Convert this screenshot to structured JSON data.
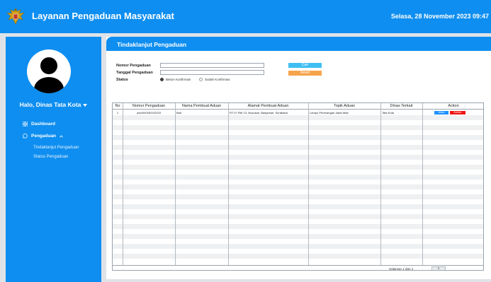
{
  "header": {
    "title": "Layanan Pengaduan Masyarakat",
    "date": "Selasa, 28 November 2023 09:47"
  },
  "sidebar": {
    "greeting": "Halo, Dinas Tata Kota",
    "items": [
      {
        "label": "Dashboard",
        "icon": "grid-icon"
      },
      {
        "label": "Pengaduan",
        "icon": "whatsapp-icon",
        "expanded": true
      }
    ],
    "subitems": [
      {
        "label": "Tindaklanjut Pengaduan"
      },
      {
        "label": "Status Pengaduan"
      }
    ]
  },
  "page": {
    "title": "Tindaklanjut Pengaduan"
  },
  "form": {
    "nomor_label": "Nomor Pengaduan",
    "nomor_value": "",
    "tanggal_label": "Tanggal Pengaduan",
    "tanggal_value": "",
    "status_label": "Status",
    "status_options": [
      "Belum Konfirmasi",
      "Sudah Konfirmasi"
    ],
    "status_selected": "Belum Konfirmasi",
    "cari_label": "Cari",
    "reset_label": "Reset"
  },
  "table": {
    "columns": [
      "No",
      "Nomor Pengaduan",
      "Nama Pembuat Aduan",
      "Alamat Pembuat Aduan",
      "Topik Aduan",
      "Dinas Terkait",
      "Action"
    ],
    "rows": [
      {
        "no": "1",
        "nomor": "adu/00045/XI/2023",
        "nama": "Bari",
        "alamat": "RT 07 RW 13, Nusukan, Banjarsari, Surakarta",
        "topik": "Lampu Penerangan Jalan Mati",
        "dinas": "Tata Kota"
      }
    ],
    "ubah_label": "Ubah",
    "delete_label": "Delete",
    "page_info": "Halaman 1 dari 1",
    "page_number": "1"
  },
  "colors": {
    "primary": "#0e8ef0",
    "cari": "#3fbef2",
    "reset": "#f6a44b",
    "ubah": "#1e90ff",
    "delete": "#f01414"
  }
}
